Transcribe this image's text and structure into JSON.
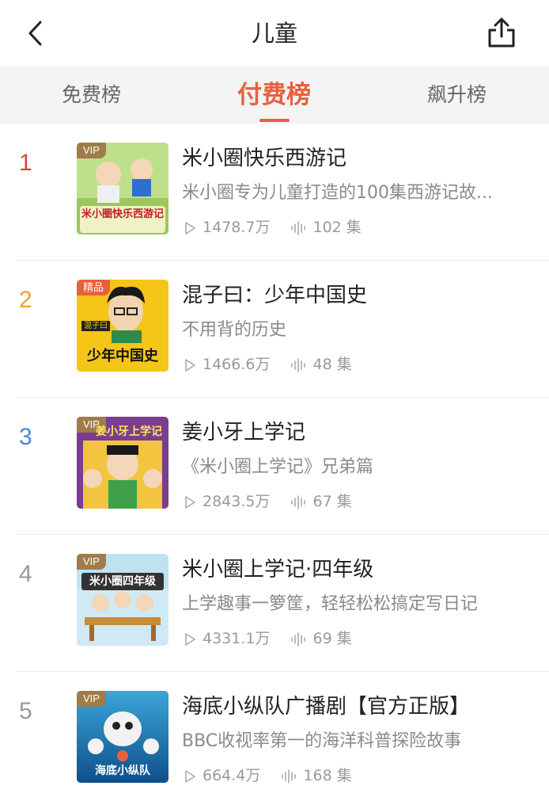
{
  "header": {
    "title": "儿童"
  },
  "tabs": [
    {
      "label": "免费榜",
      "active": false
    },
    {
      "label": "付费榜",
      "active": true
    },
    {
      "label": "飙升榜",
      "active": false
    }
  ],
  "colors": {
    "accent": "#e8613c",
    "rank1": "#d9463a",
    "rank2": "#f0a030",
    "rank3": "#4a86d6",
    "rank_other": "#999999"
  },
  "items": [
    {
      "rank": "1",
      "title": "米小圈快乐西游记",
      "desc": "米小圈专为儿童打造的100集西游记故...",
      "plays": "1478.7万",
      "episodes": "102 集",
      "badge": "VIP",
      "cover_text": "米小圈快乐西游记"
    },
    {
      "rank": "2",
      "title": "混子曰：少年中国史",
      "desc": "不用背的历史",
      "plays": "1466.6万",
      "episodes": "48 集",
      "badge": "精品",
      "cover_text": "少年中国史",
      "cover_tag": "混子曰"
    },
    {
      "rank": "3",
      "title": "姜小牙上学记",
      "desc": "《米小圈上学记》兄弟篇",
      "plays": "2843.5万",
      "episodes": "67 集",
      "badge": "VIP",
      "cover_text": "姜小牙上学记"
    },
    {
      "rank": "4",
      "title": "米小圈上学记·四年级",
      "desc": "上学趣事一箩筐，轻轻松松搞定写日记",
      "plays": "4331.1万",
      "episodes": "69 集",
      "badge": "VIP",
      "cover_text": "米小圈四年级"
    },
    {
      "rank": "5",
      "title": "海底小纵队广播剧【官方正版】",
      "desc": "BBC收视率第一的海洋科普探险故事",
      "plays": "664.4万",
      "episodes": "168 集",
      "badge": "VIP",
      "cover_text": "海底小纵队"
    }
  ],
  "icons": {
    "back": "chevron-left-icon",
    "share": "share-icon",
    "play": "play-icon",
    "episodes": "waveform-icon"
  }
}
